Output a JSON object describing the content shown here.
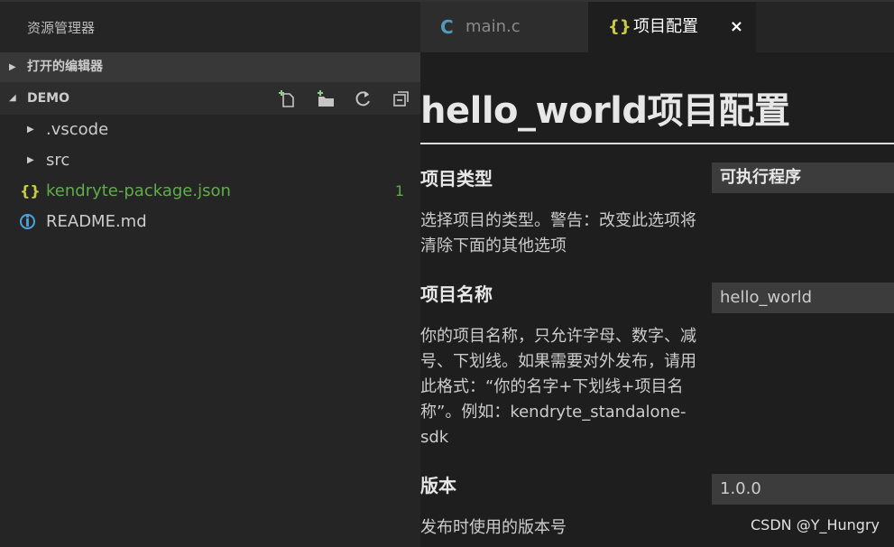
{
  "sidebar": {
    "title": "资源管理器",
    "open_editors_label": "打开的编辑器",
    "project_label": "DEMO",
    "toolbar": [
      "new-file-icon",
      "new-folder-icon",
      "refresh-icon",
      "collapse-all-icon"
    ],
    "items": [
      {
        "label": ".vscode",
        "type": "folder"
      },
      {
        "label": "src",
        "type": "folder"
      },
      {
        "label": "kendryte-package.json",
        "type": "json",
        "badge": "1"
      },
      {
        "label": "README.md",
        "type": "info"
      }
    ],
    "json_glyph": "{}"
  },
  "tabs": [
    {
      "label": "main.c",
      "icon": "C"
    },
    {
      "label": "项目配置",
      "icon": "{}",
      "close": "×"
    }
  ],
  "page": {
    "heading": "hello_world项目配置",
    "settings": [
      {
        "title": "项目类型",
        "desc": "选择项目的类型。警告：改变此选项将清除下面的其他选项",
        "value": "可执行程序"
      },
      {
        "title": "项目名称",
        "desc": "你的项目名称，只允许字母、数字、减号、下划线。如果需要对外发布，请用此格式：“你的名字+下划线+项目名称”。例如：kendryte_standalone-sdk",
        "value": "hello_world"
      },
      {
        "title": "版本",
        "desc": "发布时使用的版本号",
        "value": "1.0.0"
      }
    ]
  },
  "watermark": "CSDN @Y_Hungry",
  "colors": {
    "accent_json": "#cbcb41",
    "modified": "#5fae4a",
    "c_icon": "#519aba",
    "info": "#4aa3df"
  }
}
